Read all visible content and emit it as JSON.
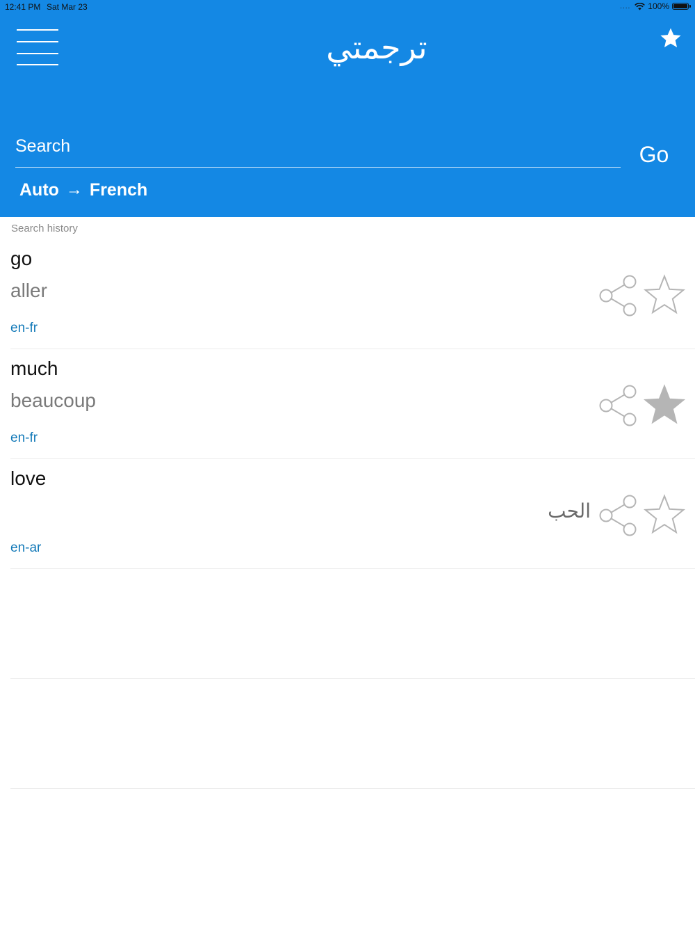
{
  "status_bar": {
    "time": "12:41 PM",
    "date": "Sat Mar 23",
    "signal": "....",
    "battery": "100%"
  },
  "header": {
    "title": "ترجمتي",
    "menu_icon": "hamburger-menu-icon",
    "favorites_icon": "star-filled-icon",
    "background_color": "#1488e4"
  },
  "search": {
    "placeholder": "Search",
    "value": "",
    "go_label": "Go"
  },
  "language": {
    "source": "Auto",
    "arrow": "→",
    "target": "French"
  },
  "history": {
    "label": "Search history",
    "items": [
      {
        "source": "go",
        "translation": "aller",
        "pair": "en-fr",
        "favorite": false,
        "rtl": false
      },
      {
        "source": "much",
        "translation": "beaucoup",
        "pair": "en-fr",
        "favorite": true,
        "rtl": false
      },
      {
        "source": "love",
        "translation": "الحب",
        "pair": "en-ar",
        "favorite": false,
        "rtl": true
      }
    ]
  },
  "colors": {
    "accent": "#1488e4",
    "pair_text": "#1279b8",
    "icon_gray": "#b5b5b5"
  }
}
